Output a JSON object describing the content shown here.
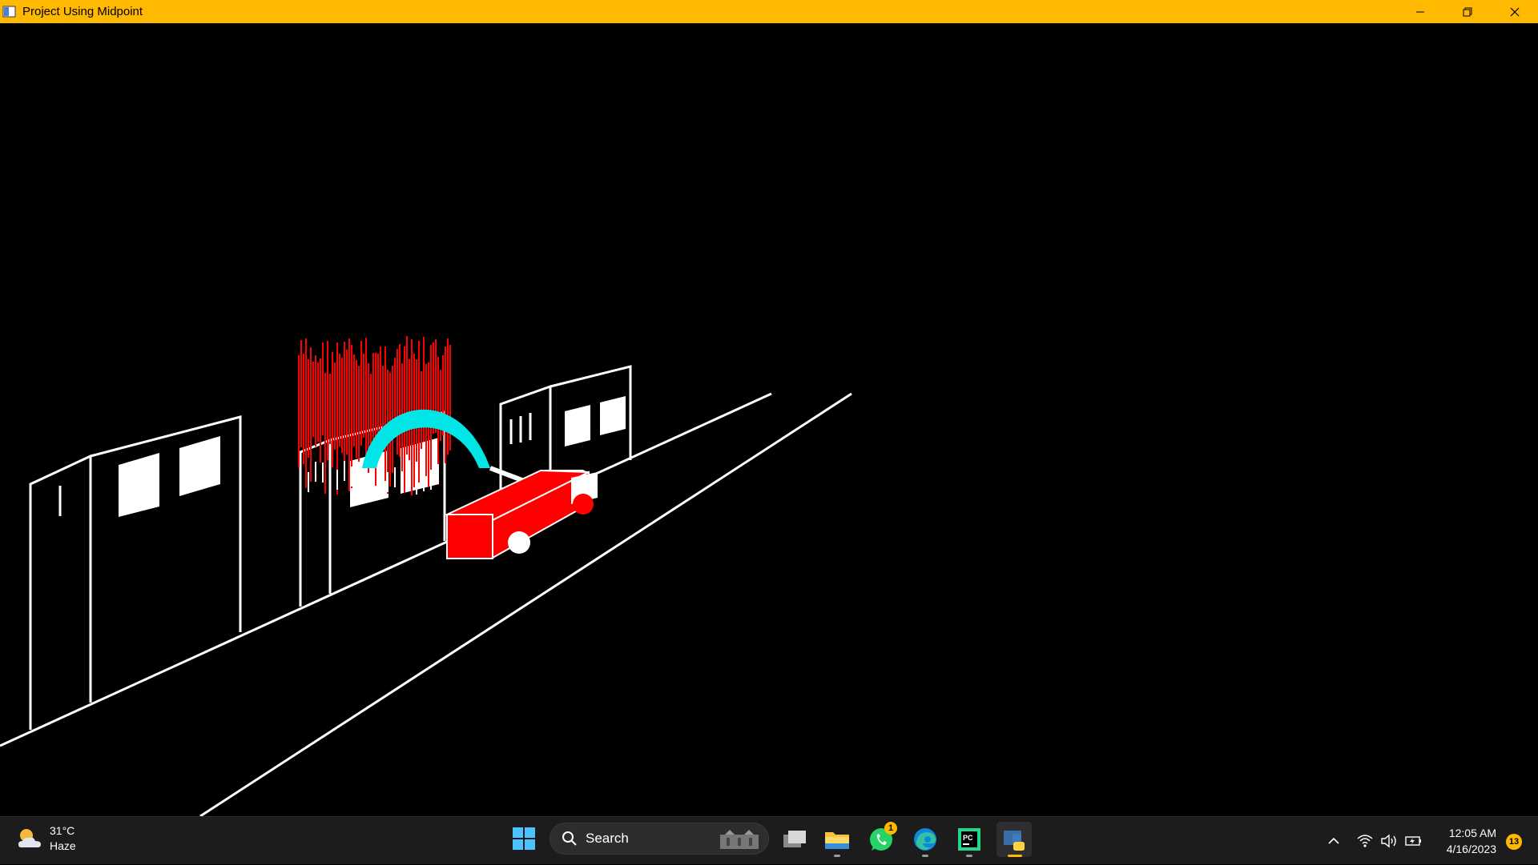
{
  "window": {
    "title": "Project Using Midpoint",
    "accent": "#ffb900"
  },
  "scene": {
    "background": "#000000",
    "line_color": "#ffffff",
    "fire_color": "#ff0000",
    "arc_color": "#00e5e5",
    "vehicle_color": "#ff0000"
  },
  "taskbar": {
    "weather": {
      "temp": "31°C",
      "condition": "Haze",
      "icon": "partly-cloudy-icon"
    },
    "search_label": "Search",
    "apps": [
      {
        "name": "task-view",
        "icon": "task-view-icon"
      },
      {
        "name": "file-explorer",
        "icon": "folder-icon"
      },
      {
        "name": "whatsapp",
        "icon": "whatsapp-icon",
        "badge": "1"
      },
      {
        "name": "edge",
        "icon": "edge-icon"
      },
      {
        "name": "pycharm",
        "icon": "pycharm-icon"
      },
      {
        "name": "python",
        "icon": "python-icon"
      }
    ],
    "clock": {
      "time": "12:05 AM",
      "date": "4/16/2023"
    },
    "notifications": "13"
  }
}
